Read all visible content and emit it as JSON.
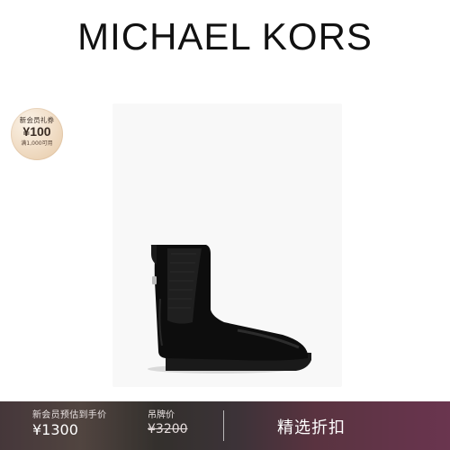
{
  "header": {
    "brand": "MICHAEL KORS"
  },
  "coupon": {
    "title": "新会员礼券",
    "amount": "¥100",
    "condition": "满1,000可用"
  },
  "product": {
    "image_icon": "ankle-boot-icon"
  },
  "bottom_bar": {
    "member_price_label": "新会员预估到手价",
    "member_price_value": "¥1300",
    "list_price_label": "吊牌价",
    "list_price_value": "¥3200",
    "promo_text": "精选折扣"
  }
}
